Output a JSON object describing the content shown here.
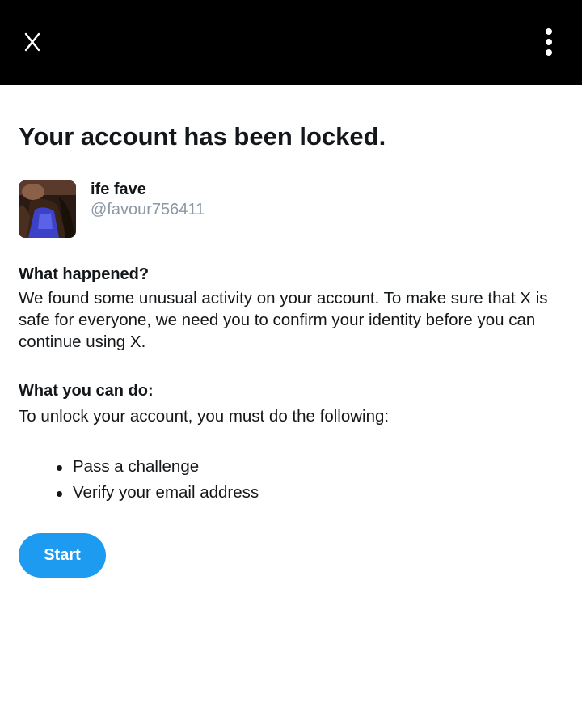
{
  "header": {
    "close_icon": "close-icon",
    "more_icon": "more-vertical-icon"
  },
  "page": {
    "title": "Your account has been locked."
  },
  "user": {
    "name": "ife fave",
    "handle": "@favour756411"
  },
  "what_happened": {
    "heading": "What happened?",
    "text": "We found some unusual activity on your account. To make sure that X is safe for everyone, we need you to confirm your identity before you can continue using X."
  },
  "what_you_can_do": {
    "heading": "What you can do:",
    "text": "To unlock your account, you must do the following:",
    "steps": [
      "Pass a challenge",
      "Verify your email address"
    ]
  },
  "actions": {
    "start_label": "Start"
  },
  "colors": {
    "header_bg": "#000000",
    "accent": "#1d9bf0",
    "handle": "#8b98a5",
    "text": "#14171a"
  }
}
